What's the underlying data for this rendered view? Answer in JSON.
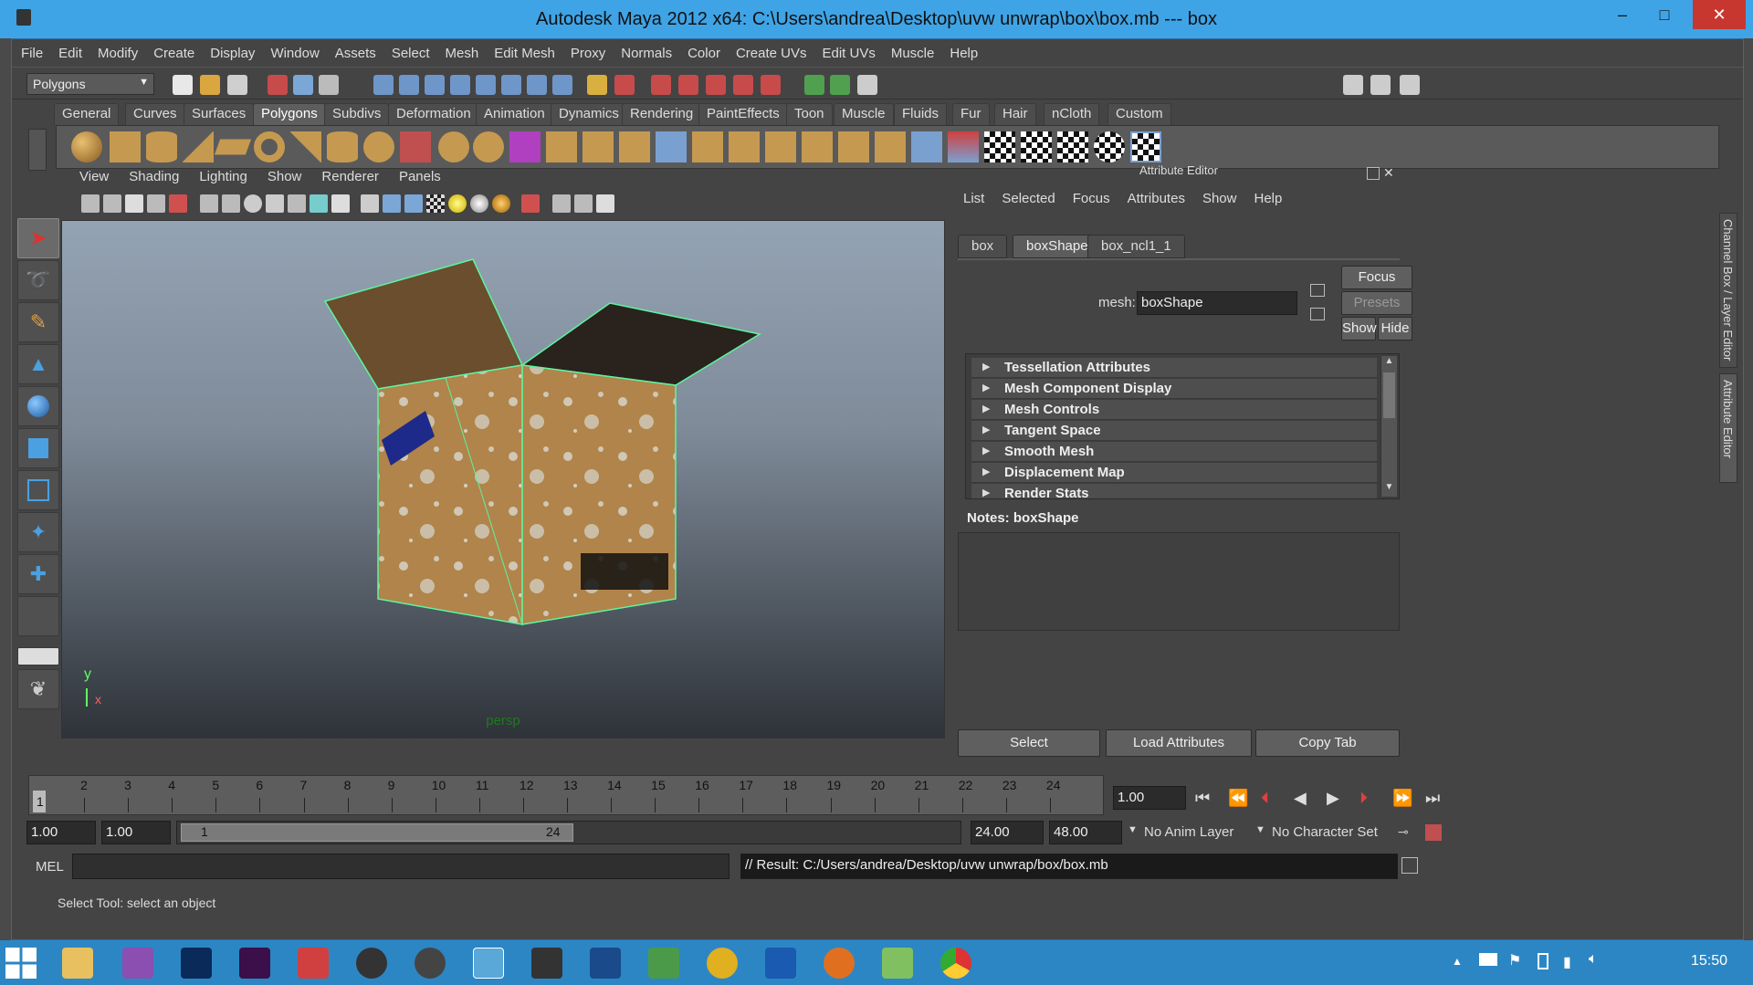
{
  "window": {
    "title": "Autodesk Maya 2012 x64: C:\\Users\\andrea\\Desktop\\uvw unwrap\\box\\box.mb   ---   box",
    "minimize": "–",
    "maximize": "□",
    "close": "✕"
  },
  "menubar": [
    "File",
    "Edit",
    "Modify",
    "Create",
    "Display",
    "Window",
    "Assets",
    "Select",
    "Mesh",
    "Edit Mesh",
    "Proxy",
    "Normals",
    "Color",
    "Create UVs",
    "Edit UVs",
    "Muscle",
    "Help"
  ],
  "statusline": {
    "menuset": "Polygons"
  },
  "shelf": {
    "tabs": [
      "General",
      "Curves",
      "Surfaces",
      "Polygons",
      "Subdivs",
      "Deformation",
      "Animation",
      "Dynamics",
      "Rendering",
      "PaintEffects",
      "Toon",
      "Muscle",
      "Fluids",
      "Fur",
      "Hair",
      "nCloth",
      "Custom"
    ],
    "active_tab": "Polygons"
  },
  "viewport": {
    "menu": [
      "View",
      "Shading",
      "Lighting",
      "Show",
      "Renderer",
      "Panels"
    ],
    "camera": "persp",
    "axis_y": "y",
    "axis_x": "x"
  },
  "attribute_editor": {
    "header": "Attribute Editor",
    "menu": [
      "List",
      "Selected",
      "Focus",
      "Attributes",
      "Show",
      "Help"
    ],
    "tabs": [
      "box",
      "boxShape",
      "box_ncl1_1"
    ],
    "active_tab": "boxShape",
    "mesh_label": "mesh:",
    "mesh_value": "boxShape",
    "focus_btn": "Focus",
    "presets_btn": "Presets",
    "show_btn": "Show",
    "hide_btn": "Hide",
    "sections": [
      "Tessellation Attributes",
      "Mesh Component Display",
      "Mesh Controls",
      "Tangent Space",
      "Smooth Mesh",
      "Displacement Map",
      "Render Stats"
    ],
    "notes_label": "Notes:  boxShape",
    "select_btn": "Select",
    "load_btn": "Load Attributes",
    "copy_btn": "Copy Tab"
  },
  "side_tabs": [
    "Channel Box / Layer Editor",
    "Attribute Editor"
  ],
  "timeslider": {
    "frames": [
      "1",
      "2",
      "3",
      "4",
      "5",
      "6",
      "7",
      "8",
      "9",
      "10",
      "11",
      "12",
      "13",
      "14",
      "15",
      "16",
      "17",
      "18",
      "19",
      "20",
      "21",
      "22",
      "23",
      "24"
    ],
    "current_frame": "1",
    "current_time": "1.00"
  },
  "range": {
    "start_time": "1.00",
    "playback_start": "1.00",
    "range_start_label": "1",
    "range_end_label": "24",
    "playback_end": "24.00",
    "end_time": "48.00",
    "anim_layer": "No Anim Layer",
    "character_set": "No Character Set"
  },
  "command": {
    "mode": "MEL",
    "result": "// Result: C:/Users/andrea/Desktop/uvw unwrap/box/box.mb"
  },
  "helpline": "Select Tool: select an object",
  "taskbar": {
    "clock": "15:50"
  },
  "colors": {
    "accent": "#3fa4e6",
    "selection": "#5cf5a0",
    "cardboard": "#b0844a"
  }
}
